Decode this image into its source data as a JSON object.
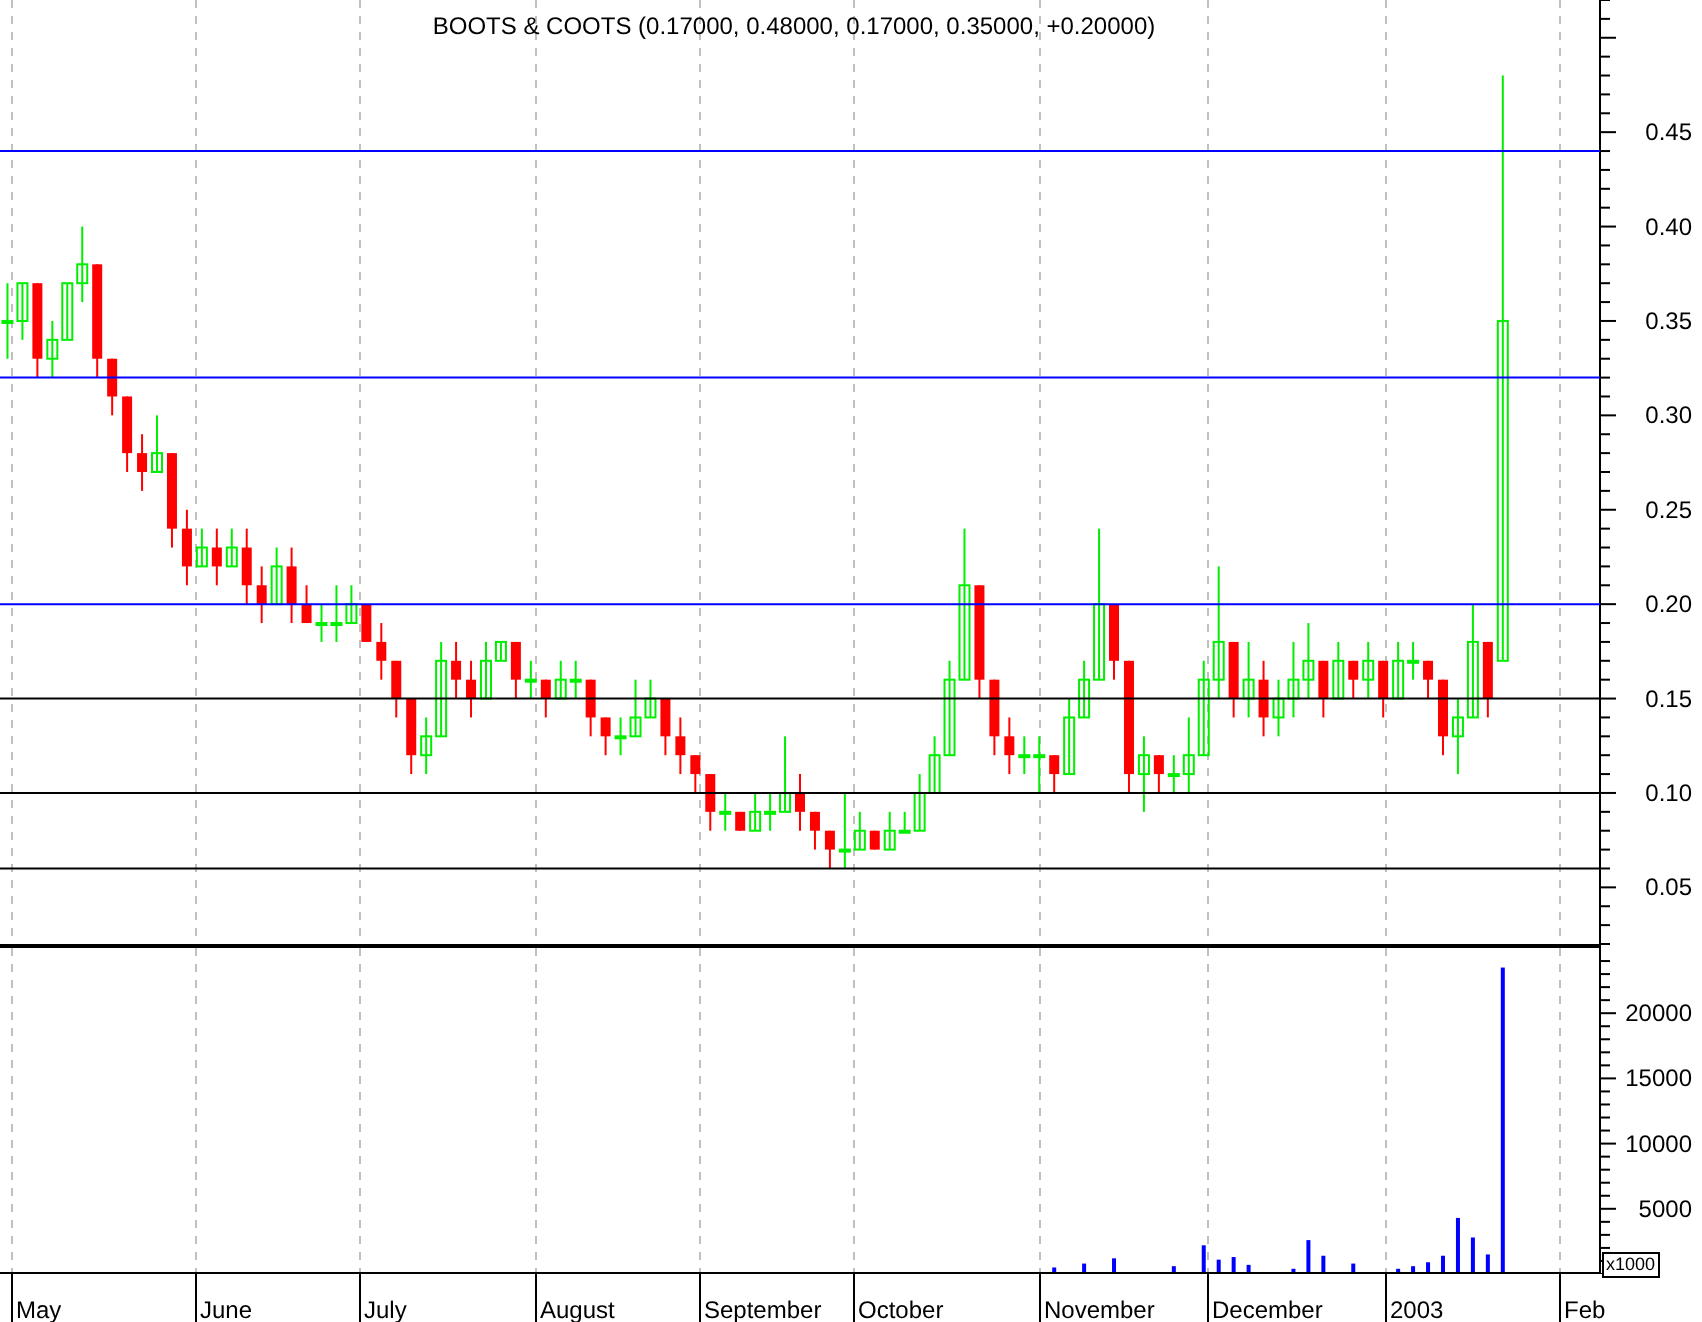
{
  "title": "BOOTS & COOTS (0.17000, 0.48000, 0.17000, 0.35000, +0.20000)",
  "price_chart": {
    "chart_data": {
      "type": "candlestick",
      "categories": [
        null,
        null,
        null,
        null,
        null,
        null,
        null,
        null,
        null,
        null,
        null,
        null,
        null,
        null,
        null,
        null,
        null,
        null,
        null,
        null,
        null,
        null,
        null,
        null,
        null,
        null,
        null,
        null,
        null,
        null,
        null,
        null,
        null,
        null,
        null,
        null,
        null,
        null,
        null,
        null,
        null,
        null,
        null,
        null,
        null,
        null,
        null,
        null,
        null,
        null,
        null,
        null,
        null,
        null,
        null,
        null,
        null,
        null,
        null,
        null,
        null,
        null,
        null,
        null,
        null,
        null,
        null,
        null,
        null,
        null,
        null,
        null,
        null,
        null,
        null,
        null,
        null,
        null,
        null,
        null,
        null,
        null,
        null,
        null,
        null,
        null,
        null,
        null,
        null,
        null,
        null,
        null,
        null,
        null,
        null,
        null,
        null,
        null,
        null,
        null,
        null,
        null,
        null,
        null,
        null,
        null,
        null
      ],
      "ohlc": [
        [
          0.35,
          0.37,
          0.33,
          0.35
        ],
        [
          0.35,
          0.37,
          0.34,
          0.37
        ],
        [
          0.37,
          0.37,
          0.32,
          0.33
        ],
        [
          0.33,
          0.35,
          0.32,
          0.34
        ],
        [
          0.34,
          0.37,
          0.34,
          0.37
        ],
        [
          0.37,
          0.4,
          0.36,
          0.38
        ],
        [
          0.38,
          0.38,
          0.32,
          0.33
        ],
        [
          0.33,
          0.33,
          0.3,
          0.31
        ],
        [
          0.31,
          0.31,
          0.27,
          0.28
        ],
        [
          0.28,
          0.29,
          0.26,
          0.27
        ],
        [
          0.27,
          0.3,
          0.27,
          0.28
        ],
        [
          0.28,
          0.28,
          0.23,
          0.24
        ],
        [
          0.24,
          0.25,
          0.21,
          0.22
        ],
        [
          0.22,
          0.24,
          0.22,
          0.23
        ],
        [
          0.23,
          0.24,
          0.21,
          0.22
        ],
        [
          0.22,
          0.24,
          0.22,
          0.23
        ],
        [
          0.23,
          0.24,
          0.2,
          0.21
        ],
        [
          0.21,
          0.22,
          0.19,
          0.2
        ],
        [
          0.2,
          0.23,
          0.2,
          0.22
        ],
        [
          0.22,
          0.23,
          0.19,
          0.2
        ],
        [
          0.2,
          0.21,
          0.19,
          0.19
        ],
        [
          0.19,
          0.2,
          0.18,
          0.19
        ],
        [
          0.19,
          0.21,
          0.18,
          0.19
        ],
        [
          0.19,
          0.21,
          0.19,
          0.2
        ],
        [
          0.2,
          0.2,
          0.18,
          0.18
        ],
        [
          0.18,
          0.19,
          0.16,
          0.17
        ],
        [
          0.17,
          0.17,
          0.14,
          0.15
        ],
        [
          0.15,
          0.15,
          0.11,
          0.12
        ],
        [
          0.12,
          0.14,
          0.11,
          0.13
        ],
        [
          0.13,
          0.18,
          0.13,
          0.17
        ],
        [
          0.17,
          0.18,
          0.15,
          0.16
        ],
        [
          0.16,
          0.17,
          0.14,
          0.15
        ],
        [
          0.15,
          0.18,
          0.15,
          0.17
        ],
        [
          0.17,
          0.18,
          0.17,
          0.18
        ],
        [
          0.18,
          0.18,
          0.15,
          0.16
        ],
        [
          0.16,
          0.17,
          0.15,
          0.16
        ],
        [
          0.16,
          0.16,
          0.14,
          0.15
        ],
        [
          0.15,
          0.17,
          0.15,
          0.16
        ],
        [
          0.16,
          0.17,
          0.15,
          0.16
        ],
        [
          0.16,
          0.16,
          0.13,
          0.14
        ],
        [
          0.14,
          0.14,
          0.12,
          0.13
        ],
        [
          0.13,
          0.14,
          0.12,
          0.13
        ],
        [
          0.13,
          0.16,
          0.13,
          0.14
        ],
        [
          0.14,
          0.16,
          0.14,
          0.15
        ],
        [
          0.15,
          0.15,
          0.12,
          0.13
        ],
        [
          0.13,
          0.14,
          0.11,
          0.12
        ],
        [
          0.12,
          0.12,
          0.1,
          0.11
        ],
        [
          0.11,
          0.11,
          0.08,
          0.09
        ],
        [
          0.09,
          0.1,
          0.08,
          0.09
        ],
        [
          0.09,
          0.09,
          0.08,
          0.08
        ],
        [
          0.08,
          0.1,
          0.08,
          0.09
        ],
        [
          0.09,
          0.1,
          0.08,
          0.09
        ],
        [
          0.09,
          0.13,
          0.09,
          0.1
        ],
        [
          0.1,
          0.11,
          0.08,
          0.09
        ],
        [
          0.09,
          0.09,
          0.07,
          0.08
        ],
        [
          0.08,
          0.08,
          0.06,
          0.07
        ],
        [
          0.07,
          0.1,
          0.06,
          0.07
        ],
        [
          0.07,
          0.09,
          0.07,
          0.08
        ],
        [
          0.08,
          0.08,
          0.07,
          0.07
        ],
        [
          0.07,
          0.09,
          0.07,
          0.08
        ],
        [
          0.08,
          0.09,
          0.08,
          0.08
        ],
        [
          0.08,
          0.11,
          0.08,
          0.1
        ],
        [
          0.1,
          0.13,
          0.1,
          0.12
        ],
        [
          0.12,
          0.17,
          0.12,
          0.16
        ],
        [
          0.16,
          0.24,
          0.16,
          0.21
        ],
        [
          0.21,
          0.21,
          0.15,
          0.16
        ],
        [
          0.16,
          0.16,
          0.12,
          0.13
        ],
        [
          0.13,
          0.14,
          0.11,
          0.12
        ],
        [
          0.12,
          0.13,
          0.11,
          0.12
        ],
        [
          0.12,
          0.13,
          0.1,
          0.12
        ],
        [
          0.12,
          0.12,
          0.1,
          0.11
        ],
        [
          0.11,
          0.15,
          0.11,
          0.14
        ],
        [
          0.14,
          0.17,
          0.14,
          0.16
        ],
        [
          0.16,
          0.24,
          0.16,
          0.2
        ],
        [
          0.2,
          0.2,
          0.16,
          0.17
        ],
        [
          0.17,
          0.17,
          0.1,
          0.11
        ],
        [
          0.11,
          0.13,
          0.09,
          0.12
        ],
        [
          0.12,
          0.12,
          0.1,
          0.11
        ],
        [
          0.11,
          0.12,
          0.1,
          0.11
        ],
        [
          0.11,
          0.14,
          0.1,
          0.12
        ],
        [
          0.12,
          0.17,
          0.12,
          0.16
        ],
        [
          0.16,
          0.22,
          0.15,
          0.18
        ],
        [
          0.18,
          0.18,
          0.14,
          0.15
        ],
        [
          0.15,
          0.18,
          0.14,
          0.16
        ],
        [
          0.16,
          0.17,
          0.13,
          0.14
        ],
        [
          0.14,
          0.16,
          0.13,
          0.15
        ],
        [
          0.15,
          0.18,
          0.14,
          0.16
        ],
        [
          0.16,
          0.19,
          0.15,
          0.17
        ],
        [
          0.17,
          0.17,
          0.14,
          0.15
        ],
        [
          0.15,
          0.18,
          0.15,
          0.17
        ],
        [
          0.17,
          0.17,
          0.15,
          0.16
        ],
        [
          0.16,
          0.18,
          0.15,
          0.17
        ],
        [
          0.17,
          0.17,
          0.14,
          0.15
        ],
        [
          0.15,
          0.18,
          0.15,
          0.17
        ],
        [
          0.17,
          0.18,
          0.16,
          0.17
        ],
        [
          0.17,
          0.17,
          0.15,
          0.16
        ],
        [
          0.16,
          0.16,
          0.12,
          0.13
        ],
        [
          0.13,
          0.15,
          0.11,
          0.14
        ],
        [
          0.14,
          0.2,
          0.14,
          0.18
        ],
        [
          0.18,
          0.18,
          0.14,
          0.15
        ],
        [
          0.17,
          0.48,
          0.17,
          0.35
        ],
        null,
        null,
        null,
        null,
        null,
        null
      ],
      "ylim": [
        0.02,
        0.52
      ],
      "grid": true,
      "yticks": [
        {
          "value": 0.45,
          "label": "0.45"
        },
        {
          "value": 0.4,
          "label": "0.40"
        },
        {
          "value": 0.35,
          "label": "0.35"
        },
        {
          "value": 0.3,
          "label": "0.30"
        },
        {
          "value": 0.25,
          "label": "0.25"
        },
        {
          "value": 0.2,
          "label": "0.20"
        },
        {
          "value": 0.15,
          "label": "0.15"
        },
        {
          "value": 0.1,
          "label": "0.10"
        },
        {
          "value": 0.05,
          "label": "0.05"
        }
      ]
    }
  },
  "volume_chart": {
    "unit": "x1000",
    "chart_data": {
      "type": "bar",
      "categories": [
        null,
        null,
        null,
        null,
        null,
        null,
        null,
        null,
        null,
        null,
        null,
        null,
        null,
        null,
        null,
        null,
        null,
        null,
        null,
        null,
        null,
        null,
        null,
        null,
        null,
        null,
        null,
        null,
        null,
        null,
        null,
        null,
        null,
        null,
        null,
        null,
        null,
        null,
        null,
        null,
        null,
        null,
        null,
        null,
        null,
        null,
        null,
        null,
        null,
        null,
        null,
        null,
        null,
        null,
        null,
        null,
        null,
        null,
        null,
        null,
        null,
        null,
        null,
        null,
        null,
        null,
        null,
        null,
        null,
        null,
        null,
        null,
        null,
        null,
        null,
        null,
        null,
        null,
        null,
        null,
        null,
        null,
        null,
        null,
        null,
        null,
        null,
        null,
        null,
        null,
        null,
        null,
        null,
        null,
        null,
        null,
        null,
        null,
        null,
        null,
        null,
        null,
        null,
        null,
        null,
        null,
        null
      ],
      "values": [
        0,
        0,
        0,
        0,
        0,
        0,
        0,
        0,
        0,
        0,
        0,
        0,
        0,
        0,
        0,
        0,
        0,
        0,
        0,
        0,
        0,
        0,
        0,
        0,
        0,
        0,
        0,
        0,
        0,
        0,
        0,
        0,
        0,
        0,
        0,
        0,
        0,
        0,
        0,
        0,
        0,
        0,
        0,
        0,
        0,
        0,
        0,
        0,
        0,
        0,
        0,
        0,
        0,
        0,
        0,
        0,
        0,
        0,
        0,
        0,
        0,
        0,
        0,
        0,
        0,
        0,
        0,
        0,
        0,
        null,
        500,
        0,
        800,
        0,
        1200,
        0,
        null,
        0,
        600,
        0,
        2200,
        1100,
        1300,
        700,
        0,
        0,
        400,
        2600,
        1400,
        0,
        800,
        0,
        0,
        400,
        600,
        900,
        1400,
        4300,
        2800,
        1500,
        23500,
        null,
        null,
        null,
        null,
        null,
        null
      ],
      "ylim": [
        0,
        25000
      ],
      "grid": true,
      "yticks": [
        {
          "value": 20000,
          "label": "20000"
        },
        {
          "value": 15000,
          "label": "15000"
        },
        {
          "value": 10000,
          "label": "10000"
        },
        {
          "value": 5000,
          "label": "5000"
        }
      ]
    }
  },
  "months": [
    "May",
    "June",
    "July",
    "August",
    "September",
    "October",
    "November",
    "December",
    "2003",
    "Feb"
  ]
}
